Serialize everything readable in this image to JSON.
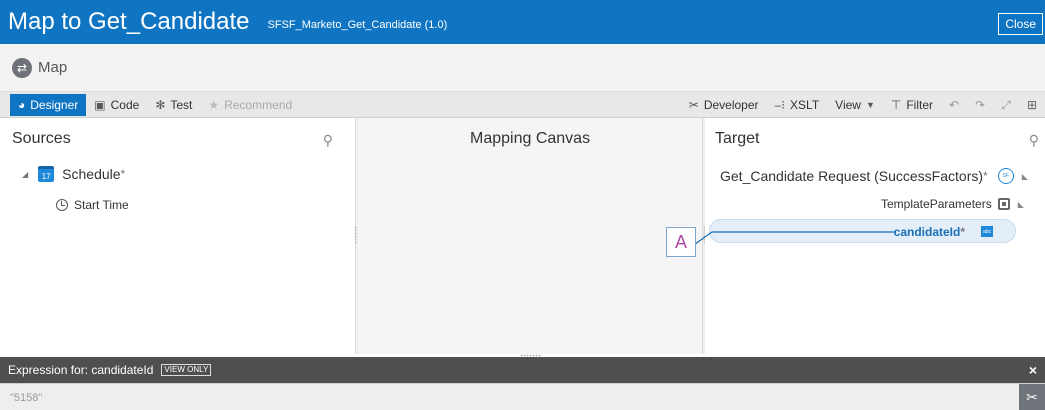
{
  "header": {
    "title": "Map to Get_Candidate",
    "subtitle": "SFSF_Marketo_Get_Candidate (1.0)",
    "close_label": "Close"
  },
  "map_row": {
    "label": "Map",
    "icon": "map-icon"
  },
  "toolbar": {
    "designer": "Designer",
    "code": "Code",
    "test": "Test",
    "recommend": "Recommend",
    "developer": "Developer",
    "xslt": "XSLT",
    "view": "View",
    "filter": "Filter"
  },
  "sources": {
    "title": "Sources",
    "schedule_label": "Schedule",
    "required_mark": "*",
    "start_time_label": "Start Time"
  },
  "canvas": {
    "title": "Mapping Canvas",
    "function_symbol": "A"
  },
  "target": {
    "title": "Target",
    "request_label": "Get_Candidate Request (SuccessFactors)",
    "required_mark": "*",
    "template_params_label": "TemplateParameters",
    "candidate_label": "candidateId",
    "candidate_required": "*",
    "abc_text": "abc"
  },
  "expression": {
    "label": "Expression for: candidateId",
    "view_only": "VIEW ONLY",
    "value": "\"5158\"",
    "close_symbol": "×"
  },
  "colors": {
    "accent": "#0f75c2",
    "link": "#1a6fb5",
    "function_color": "#b04aa8",
    "expression_bar": "#4f4f4f"
  }
}
